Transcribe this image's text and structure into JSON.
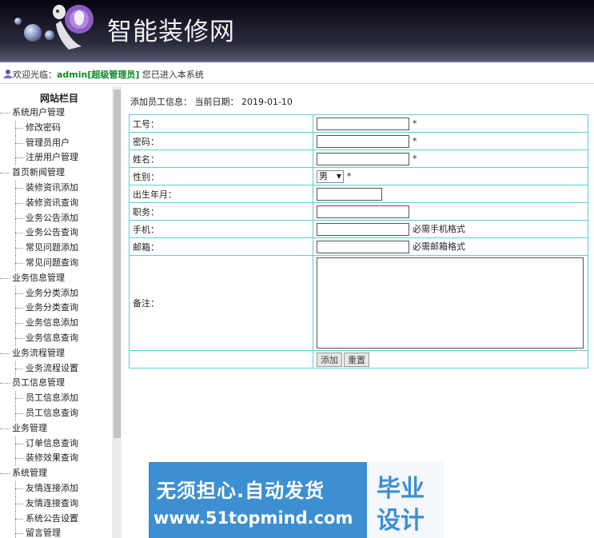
{
  "header": {
    "site_title": "智能装修网"
  },
  "welcome": {
    "prefix": "欢迎光临：",
    "user": "admin[超级管理员]",
    "suffix": " 您已进入本系统"
  },
  "sidebar": {
    "title": "网站栏目",
    "items": [
      {
        "type": "group",
        "label": "系统用户管理"
      },
      {
        "type": "sub",
        "label": "修改密码"
      },
      {
        "type": "sub",
        "label": "管理员用户"
      },
      {
        "type": "sub",
        "label": "注册用户管理"
      },
      {
        "type": "group",
        "label": "首页新闻管理"
      },
      {
        "type": "sub",
        "label": "装修资讯添加"
      },
      {
        "type": "sub",
        "label": "装修资讯查询"
      },
      {
        "type": "sub",
        "label": "业务公告添加"
      },
      {
        "type": "sub",
        "label": "业务公告查询"
      },
      {
        "type": "sub",
        "label": "常见问题添加"
      },
      {
        "type": "sub",
        "label": "常见问题查询"
      },
      {
        "type": "group",
        "label": "业务信息管理"
      },
      {
        "type": "sub",
        "label": "业务分类添加"
      },
      {
        "type": "sub",
        "label": "业务分类查询"
      },
      {
        "type": "sub",
        "label": "业务信息添加"
      },
      {
        "type": "sub",
        "label": "业务信息查询"
      },
      {
        "type": "group",
        "label": "业务流程管理"
      },
      {
        "type": "sub",
        "label": "业务流程设置"
      },
      {
        "type": "group",
        "label": "员工信息管理"
      },
      {
        "type": "sub",
        "label": "员工信息添加"
      },
      {
        "type": "sub",
        "label": "员工信息查询"
      },
      {
        "type": "group",
        "label": "业务管理"
      },
      {
        "type": "sub",
        "label": "订单信息查询"
      },
      {
        "type": "sub",
        "label": "装修效果查询"
      },
      {
        "type": "group",
        "label": "系统管理"
      },
      {
        "type": "sub",
        "label": "友情连接添加"
      },
      {
        "type": "sub",
        "label": "友情连接查询"
      },
      {
        "type": "sub",
        "label": "系统公告设置"
      },
      {
        "type": "sub",
        "label": "留言管理"
      }
    ]
  },
  "form": {
    "caption": "添加员工信息： 当前日期： 2019-01-10",
    "labels": {
      "emp_no": "工号：",
      "password": "密码：",
      "name": "姓名：",
      "gender": "性别：",
      "birth": "出生年月：",
      "position": "职务：",
      "phone": "手机：",
      "email": "邮箱：",
      "remark": "备注："
    },
    "values": {
      "emp_no": "",
      "password": "",
      "name": "",
      "birth": "",
      "position": "",
      "phone": "",
      "email": "",
      "remark": ""
    },
    "gender_selected": "男",
    "required_mark": "*",
    "phone_hint": "必需手机格式",
    "email_hint": "必需邮箱格式",
    "add_button": "添加",
    "reset_button": "重置"
  },
  "banner": {
    "line1": "无须担心.自动发货",
    "line2": "www.51topmind.com",
    "right1": "毕业",
    "right2": "设计"
  }
}
